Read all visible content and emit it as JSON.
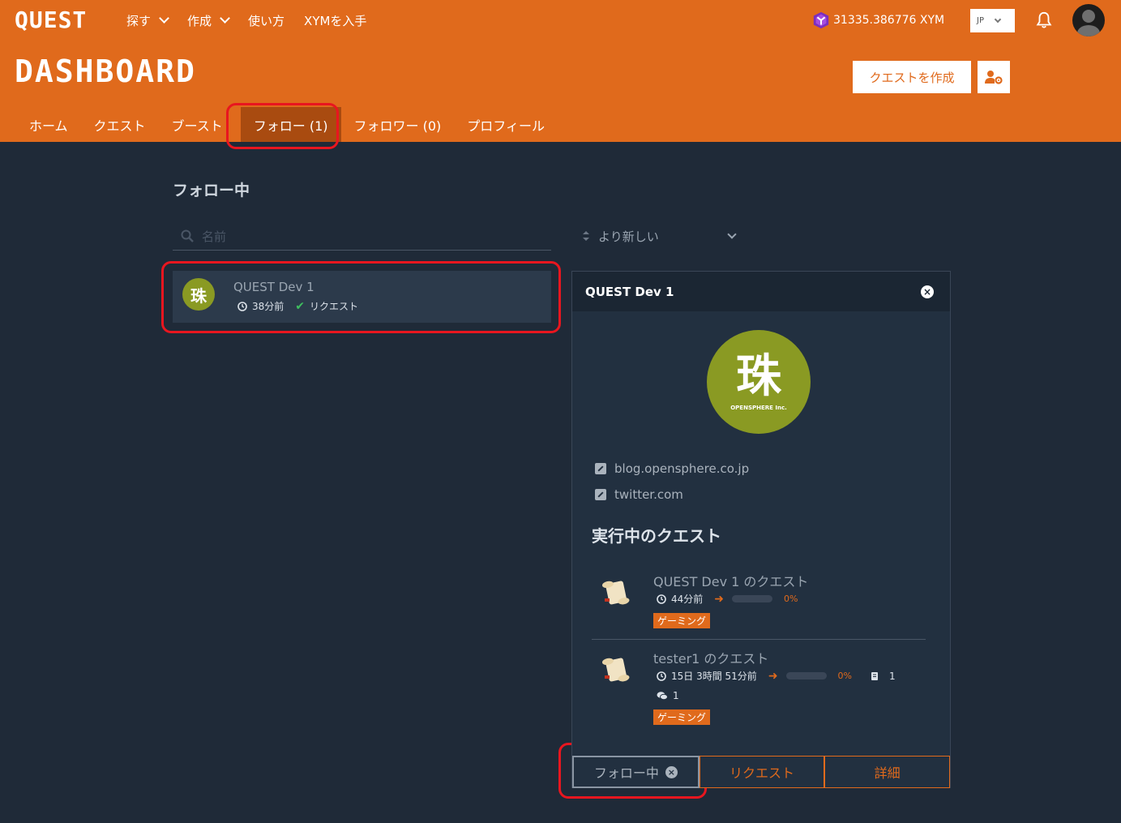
{
  "header": {
    "logo": "QUEST",
    "nav": [
      {
        "label": "探す",
        "dropdown": true
      },
      {
        "label": "作成",
        "dropdown": true
      },
      {
        "label": "使い方",
        "dropdown": false
      },
      {
        "label": "XYMを入手",
        "dropdown": false
      }
    ],
    "balance": "31335.386776 XYM",
    "language": "JP",
    "page_title": "DASHBOARD",
    "create_quest": "クエストを作成"
  },
  "tabs": [
    "ホーム",
    "クエスト",
    "ブースト",
    "フォロー (1)",
    "フォロワー (0)",
    "プロフィール"
  ],
  "active_tab": "フォロー (1)",
  "following": {
    "title": "フォロー中",
    "search_placeholder": "名前",
    "sort_label": "より新しい",
    "items": [
      {
        "name": "QUEST Dev 1",
        "time": "38分前",
        "status": "リクエスト"
      }
    ]
  },
  "detail": {
    "name": "QUEST Dev 1",
    "avatar_brand": "OPENSPHERE Inc.",
    "links": [
      "blog.opensphere.co.jp",
      "twitter.com"
    ],
    "active_quests_title": "実行中のクエスト",
    "quests": [
      {
        "name": "QUEST Dev 1 のクエスト",
        "time": "44分前",
        "progress": "0%",
        "tag": "ゲーミング"
      },
      {
        "name": "tester1 のクエスト",
        "time": "15日 3時間 51分前",
        "progress": "0%",
        "documents": "1",
        "comments": "1",
        "tag": "ゲーミング"
      }
    ],
    "buttons": {
      "following": "フォロー中",
      "request": "リクエスト",
      "details": "詳細"
    }
  },
  "colors": {
    "accent": "#e06a1c",
    "background": "#1f2a38",
    "panel": "#223040",
    "highlight": "#e8161f"
  }
}
